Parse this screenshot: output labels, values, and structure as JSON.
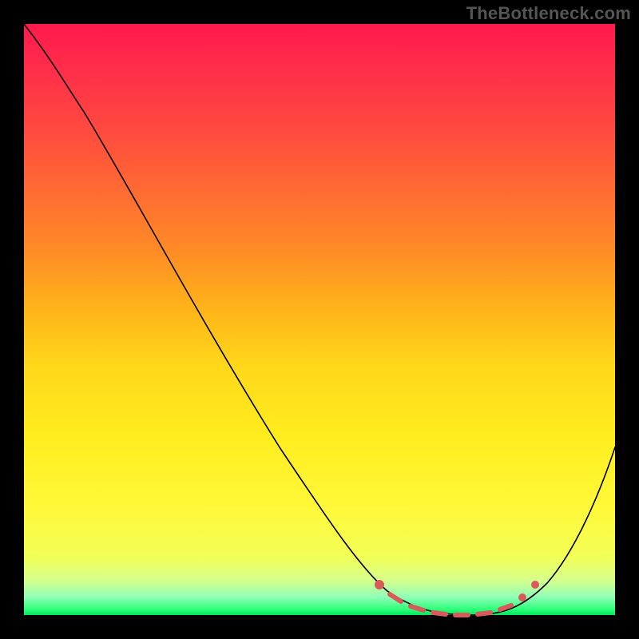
{
  "watermark": "TheBottleneck.com",
  "colors": {
    "page_bg": "#000000",
    "gradient_top": "#ff1a4d",
    "gradient_bottom": "#00e85e",
    "curve": "#000000",
    "marker": "#d95a5a"
  },
  "chart_data": {
    "type": "line",
    "title": "",
    "xlabel": "",
    "ylabel": "",
    "xlim": [
      0,
      100
    ],
    "ylim": [
      0,
      100
    ],
    "grid": false,
    "series": [
      {
        "name": "bottleneck-curve",
        "x": [
          0,
          4,
          10,
          18,
          26,
          34,
          42,
          50,
          56,
          60,
          63,
          66,
          69,
          72,
          75,
          78,
          81,
          84,
          88,
          92,
          96,
          100
        ],
        "y": [
          100,
          95,
          88,
          78,
          67,
          56,
          45,
          33,
          24,
          17,
          12,
          8,
          5,
          3,
          1,
          0,
          0.5,
          2,
          6,
          12,
          20,
          28
        ]
      }
    ],
    "annotations": {
      "optimal_range_x": [
        61,
        83
      ],
      "optimal_range_style": "salmon-dashes"
    }
  }
}
